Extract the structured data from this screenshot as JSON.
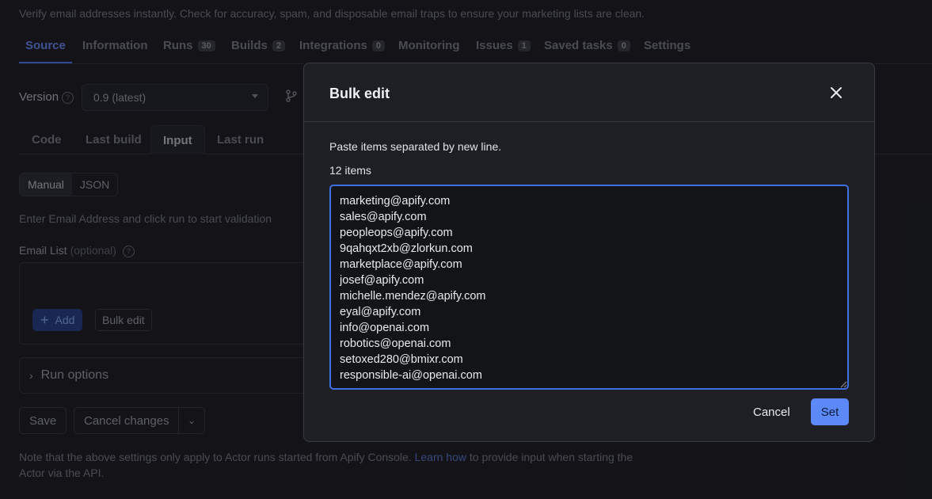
{
  "page": {
    "description": "Verify email addresses instantly. Check for accuracy, spam, and disposable email traps to ensure your marketing lists are clean.",
    "tabs": [
      {
        "label": "Source",
        "badge": ""
      },
      {
        "label": "Information",
        "badge": ""
      },
      {
        "label": "Runs",
        "badge": "30"
      },
      {
        "label": "Builds",
        "badge": "2"
      },
      {
        "label": "Integrations",
        "badge": "0"
      },
      {
        "label": "Monitoring",
        "badge": ""
      },
      {
        "label": "Issues",
        "badge": "1"
      },
      {
        "label": "Saved tasks",
        "badge": "0"
      },
      {
        "label": "Settings",
        "badge": ""
      }
    ],
    "version_label": "Version",
    "version_value": "0.9 (latest)",
    "subtabs": [
      "Code",
      "Last build",
      "Input",
      "Last run"
    ],
    "mode": {
      "manual": "Manual",
      "json": "JSON"
    },
    "hint": "Enter Email Address and click run to start validation",
    "email_list_label": "Email List",
    "email_list_optional": "(optional)",
    "add_label": "Add",
    "bulk_edit_label": "Bulk edit",
    "run_options_label": "Run options",
    "save_label": "Save",
    "cancel_changes_label": "Cancel changes",
    "note_before": "Note that the above settings only apply to Actor runs started from Apify Console.",
    "note_link": "Learn how",
    "note_after": "to provide input when starting the Actor via the API."
  },
  "modal": {
    "title": "Bulk edit",
    "instruction": "Paste items separated by new line.",
    "count": "12 items",
    "items": [
      "marketing@apify.com",
      "sales@apify.com",
      "peopleops@apify.com",
      "9qahqxt2xb@zlorkun.com",
      "marketplace@apify.com",
      "josef@apify.com",
      "michelle.mendez@apify.com",
      "eyal@apify.com",
      "info@openai.com",
      "robotics@openai.com",
      "setoxed280@bmixr.com",
      "responsible-ai@openai.com"
    ],
    "cancel_label": "Cancel",
    "set_label": "Set"
  },
  "colors": {
    "accent": "#5b8af8",
    "background": "#1a1b21",
    "modal": "#1e1f24"
  }
}
